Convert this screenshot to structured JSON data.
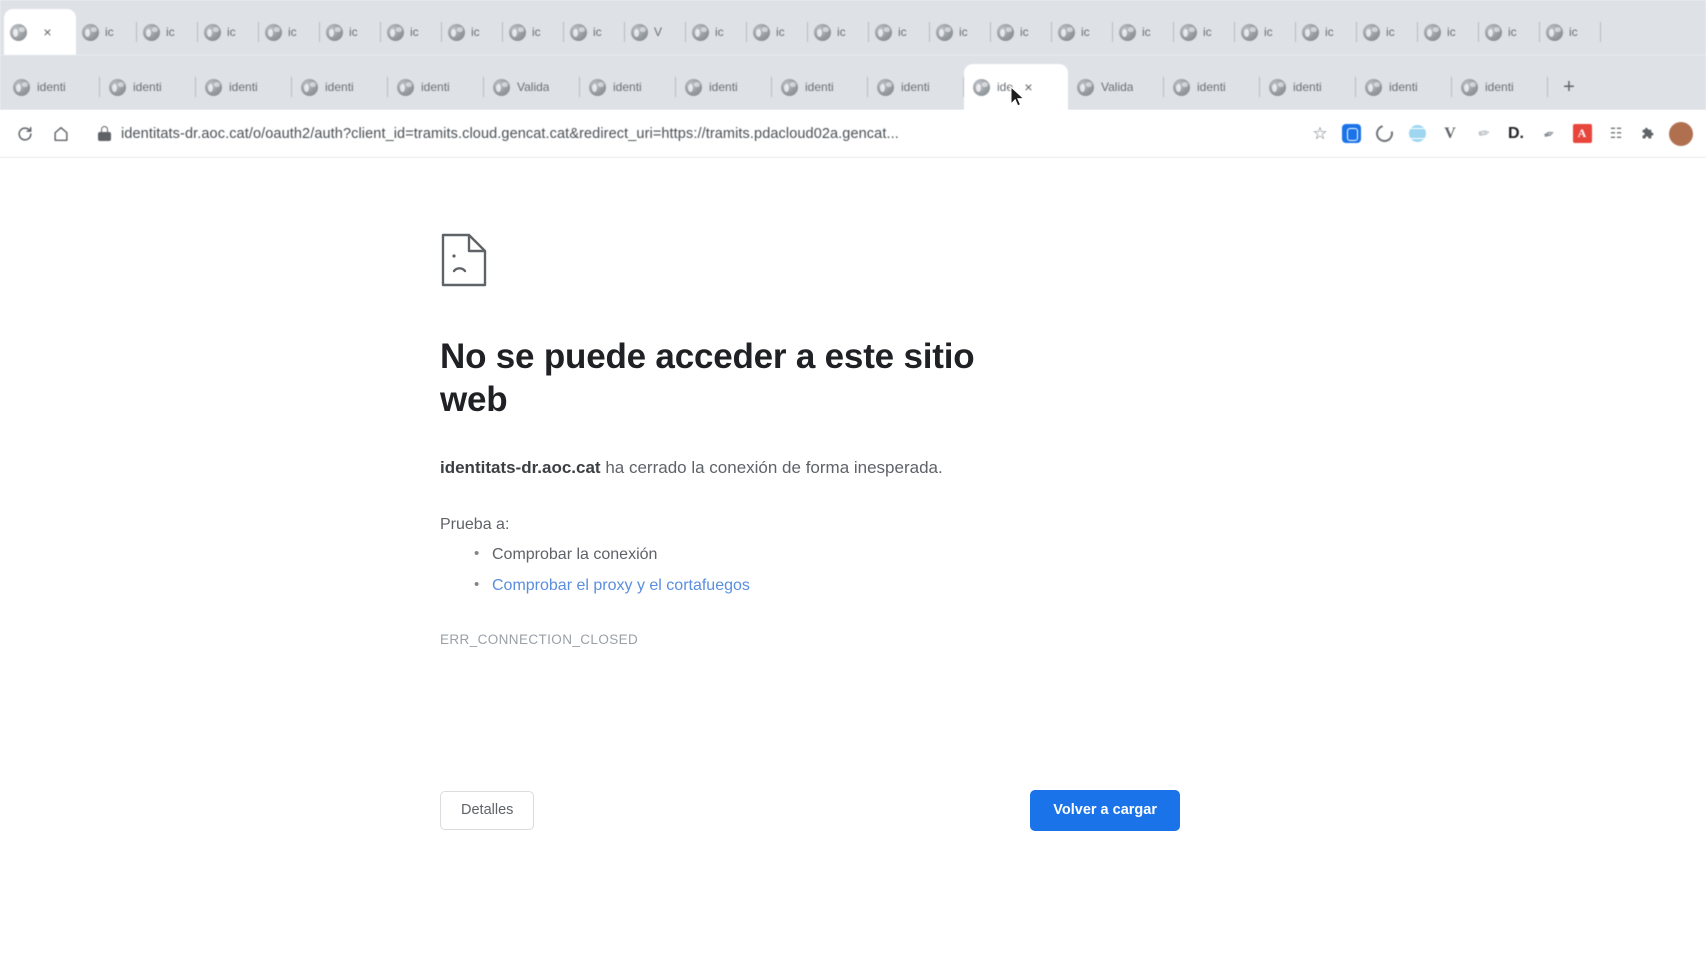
{
  "browser": {
    "tab_rows": [
      {
        "name": "tab-row-1",
        "tabs": [
          {
            "label": "",
            "active": true,
            "close": "×"
          },
          {
            "label": "ic",
            "active": false
          },
          {
            "label": "ic",
            "active": false
          },
          {
            "label": "ic",
            "active": false
          },
          {
            "label": "ic",
            "active": false
          },
          {
            "label": "ic",
            "active": false
          },
          {
            "label": "ic",
            "active": false
          },
          {
            "label": "ic",
            "active": false
          },
          {
            "label": "ic",
            "active": false
          },
          {
            "label": "ic",
            "active": false
          },
          {
            "label": "V",
            "active": false
          },
          {
            "label": "ic",
            "active": false
          },
          {
            "label": "ic",
            "active": false
          },
          {
            "label": "ic",
            "active": false
          },
          {
            "label": "ic",
            "active": false
          },
          {
            "label": "ic",
            "active": false
          },
          {
            "label": "ic",
            "active": false
          },
          {
            "label": "ic",
            "active": false
          },
          {
            "label": "ic",
            "active": false
          },
          {
            "label": "ic",
            "active": false
          },
          {
            "label": "ic",
            "active": false
          },
          {
            "label": "ic",
            "active": false
          },
          {
            "label": "ic",
            "active": false
          },
          {
            "label": "ic",
            "active": false
          },
          {
            "label": "ic",
            "active": false
          },
          {
            "label": "ic",
            "active": false
          }
        ]
      },
      {
        "name": "tab-row-2",
        "tabs": [
          {
            "label": "identi",
            "active": false
          },
          {
            "label": "identi",
            "active": false
          },
          {
            "label": "identi",
            "active": false
          },
          {
            "label": "identi",
            "active": false
          },
          {
            "label": "identi",
            "active": false
          },
          {
            "label": "Valida",
            "active": false
          },
          {
            "label": "identi",
            "active": false
          },
          {
            "label": "identi",
            "active": false
          },
          {
            "label": "identi",
            "active": false
          },
          {
            "label": "identi",
            "active": false
          },
          {
            "label": "ide",
            "active": true,
            "close": "×"
          },
          {
            "label": "Valida",
            "active": false
          },
          {
            "label": "identi",
            "active": false
          },
          {
            "label": "identi",
            "active": false
          },
          {
            "label": "identi",
            "active": false
          },
          {
            "label": "identi",
            "active": false
          }
        ],
        "new_tab_label": "+"
      }
    ],
    "toolbar": {
      "reload_icon": "reload-icon",
      "home_icon": "home-icon",
      "lock_icon": "lock-icon",
      "url": "identitats-dr.aoc.cat/o/oauth2/auth?client_id=tramits.cloud.gencat.cat&redirect_uri=https://tramits.pdacloud02a.gencat...",
      "bookmark_star": "☆",
      "extensions": [
        {
          "name": "extension-blue-icon",
          "glyph": ""
        },
        {
          "name": "extension-ring-icon",
          "glyph": ""
        },
        {
          "name": "extension-globe-icon",
          "glyph": ""
        },
        {
          "name": "extension-v-icon",
          "glyph": "V"
        },
        {
          "name": "extension-pin-icon",
          "glyph": "✐"
        },
        {
          "name": "extension-d-icon",
          "glyph": "D."
        },
        {
          "name": "extension-pen-icon",
          "glyph": "✒"
        },
        {
          "name": "extension-acrobat-icon",
          "glyph": "A"
        },
        {
          "name": "extension-grid-icon",
          "glyph": "☷"
        },
        {
          "name": "extensions-puzzle-icon",
          "glyph": "❖"
        }
      ],
      "profile_avatar": "avatar"
    }
  },
  "error_page": {
    "icon": "sad-page-icon",
    "title": "No se puede acceder a este sitio web",
    "subtitle_host": "identitats-dr.aoc.cat",
    "subtitle_rest": " ha cerrado la conexión de forma inesperada.",
    "try_header": "Prueba a:",
    "suggestions": [
      {
        "text": "Comprobar la conexión",
        "is_link": false
      },
      {
        "text": "Comprobar el proxy y el cortafuegos",
        "is_link": true
      }
    ],
    "error_code": "ERR_CONNECTION_CLOSED",
    "details_button": "Detalles",
    "reload_button": "Volver a cargar"
  },
  "colors": {
    "accent_blue": "#1a73e8",
    "link_blue": "#5a8ede",
    "tabstrip_bg": "#dee1e6",
    "text_primary": "#202124",
    "text_secondary": "#5f6368"
  }
}
